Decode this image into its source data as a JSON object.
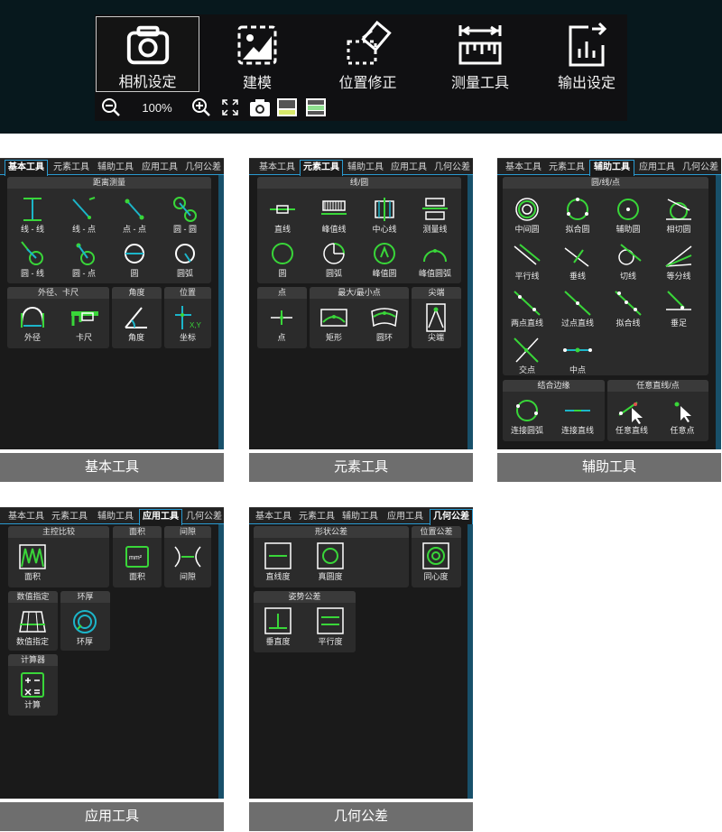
{
  "toolbar": {
    "buttons": [
      {
        "label": "相机设定",
        "icon": "camera-icon"
      },
      {
        "label": "建模",
        "icon": "modeling-icon"
      },
      {
        "label": "位置修正",
        "icon": "position-correction-icon"
      },
      {
        "label": "测量工具",
        "icon": "ruler-icon"
      },
      {
        "label": "输出设定",
        "icon": "output-chart-icon"
      }
    ],
    "zoom_value": "100%",
    "zoom_icons": [
      "zoom-out-icon",
      "zoom-in-icon",
      "fit-screen-icon",
      "snapshot-icon",
      "view-mode-1-icon",
      "view-mode-2-icon"
    ]
  },
  "tabs": [
    "基本工具",
    "元素工具",
    "辅助工具",
    "应用工具",
    "几何公差"
  ],
  "panel_basic": {
    "caption": "基本工具",
    "groups": {
      "distance": "距离测量",
      "diameter": "外径、卡尺",
      "angle": "角度",
      "position": "位置"
    },
    "tools": [
      "线 - 线",
      "线 - 点",
      "点 - 点",
      "圆 - 圆",
      "圆 - 线",
      "圆 - 点",
      "圆",
      "圆弧",
      "外径",
      "卡尺",
      "角度",
      "坐标"
    ]
  },
  "panel_element": {
    "caption": "元素工具",
    "groups": {
      "line_circle": "线/圆",
      "point": "点",
      "maxmin": "最大/最小点",
      "peak": "尖端"
    },
    "tools": [
      "直线",
      "峰值线",
      "中心线",
      "测量线",
      "圆",
      "圆弧",
      "峰值圆",
      "峰值圆弧",
      "点",
      "矩形",
      "圆环",
      "尖端"
    ]
  },
  "panel_aux": {
    "caption": "辅助工具",
    "groups": {
      "circle_line_point": "圆/线/点",
      "combine_edge": "结合边缘",
      "any_line_point": "任意直线/点"
    },
    "tools": [
      "中间圆",
      "拟合圆",
      "辅助圆",
      "相切圆",
      "平行线",
      "垂线",
      "切线",
      "等分线",
      "两点直线",
      "过点直线",
      "拟合线",
      "垂足",
      "交点",
      "中点",
      "连接圆弧",
      "连接直线",
      "任意直线",
      "任意点"
    ]
  },
  "panel_app": {
    "caption": "应用工具",
    "groups": {
      "master": "主控比较",
      "area": "面积",
      "gap": "间隙",
      "numeric": "数值指定",
      "ring": "环厚",
      "calc": "计算器"
    },
    "tools": [
      "面积",
      "面积",
      "间隙",
      "数值指定",
      "环厚",
      "计算"
    ],
    "area_unit": "mm²"
  },
  "panel_geo": {
    "caption": "几何公差",
    "groups": {
      "form": "形状公差",
      "location": "位置公差",
      "orientation": "姿势公差"
    },
    "tools": [
      "直线度",
      "真圆度",
      "同心度",
      "垂直度",
      "平行度"
    ]
  },
  "coord_label": "X,Y",
  "colors": {
    "accent": "#2a9ad0",
    "tool_green": "#39d639",
    "tool_teal": "#1cb5c9",
    "caption_bg": "#6e6e6e"
  }
}
